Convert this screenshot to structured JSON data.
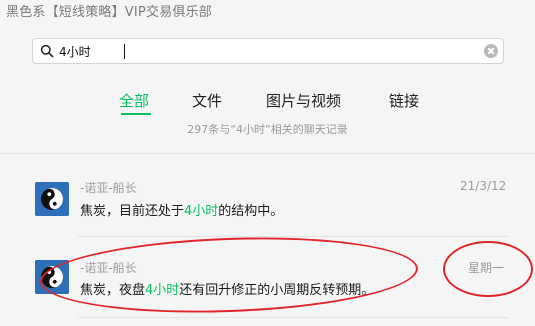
{
  "window": {
    "title": "黑色系【短线策略】VIP交易俱乐部"
  },
  "search": {
    "query": "4小时"
  },
  "tabs": [
    {
      "label": "全部",
      "active": true
    },
    {
      "label": "文件",
      "active": false
    },
    {
      "label": "图片与视频",
      "active": false
    },
    {
      "label": "链接",
      "active": false
    }
  ],
  "summary": "297条与“4小时”相关的聊天记录",
  "results": [
    {
      "sender": "-诺亚-船长",
      "time": "21/3/12",
      "text_before": "焦炭，目前还处于",
      "highlight": "4小时",
      "text_after": "的结构中。"
    },
    {
      "sender": "-诺亚-船长",
      "time": "星期一",
      "text_before": "焦炭，夜盘",
      "highlight": "4小时",
      "text_after": "还有回升修正的小周期反转预期。"
    }
  ],
  "colors": {
    "accent": "#07c160",
    "annotation": "#e0262b",
    "avatar_bg": "#2d6fb8"
  },
  "icons": {
    "search": "magnifier-icon",
    "clear": "clear-circle-icon",
    "avatar": "yin-yang-icon"
  }
}
